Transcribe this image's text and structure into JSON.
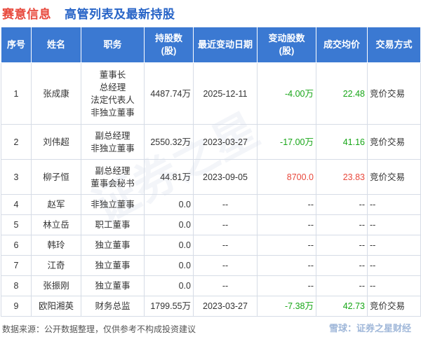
{
  "header": {
    "company": "赛意信息",
    "title": "高管列表及最新持股"
  },
  "table": {
    "columns": [
      "序号",
      "姓名",
      "职务",
      "持股数\n(股)",
      "最近变动日期",
      "变动股数\n(股)",
      "成交均价",
      "交易方式"
    ],
    "rows": [
      {
        "no": "1",
        "name": "张成康",
        "roles": [
          "董事长",
          "总经理",
          "法定代表人",
          "非独立董事"
        ],
        "shares": "4487.74万",
        "date": "2025-12-11",
        "change": "-4.00万",
        "change_color": "#17a617",
        "price": "22.48",
        "price_color": "#17a617",
        "method": "竞价交易"
      },
      {
        "no": "2",
        "name": "刘伟超",
        "roles": [
          "副总经理",
          "非独立董事"
        ],
        "shares": "2550.32万",
        "date": "2023-03-27",
        "change": "-17.00万",
        "change_color": "#17a617",
        "price": "41.16",
        "price_color": "#17a617",
        "method": "竞价交易"
      },
      {
        "no": "3",
        "name": "柳子恒",
        "roles": [
          "副总经理",
          "董事会秘书"
        ],
        "shares": "44.81万",
        "date": "2023-09-05",
        "change": "8700.0",
        "change_color": "#e8483c",
        "price": "23.83",
        "price_color": "#e8483c",
        "method": "竞价交易"
      },
      {
        "no": "4",
        "name": "赵军",
        "roles": [
          "非独立董事"
        ],
        "shares": "0.0",
        "date": "--",
        "change": "--",
        "change_color": "#333333",
        "price": "--",
        "price_color": "#333333",
        "method": "--"
      },
      {
        "no": "5",
        "name": "林立岳",
        "roles": [
          "职工董事"
        ],
        "shares": "0.0",
        "date": "--",
        "change": "--",
        "change_color": "#333333",
        "price": "--",
        "price_color": "#333333",
        "method": "--"
      },
      {
        "no": "6",
        "name": "韩玲",
        "roles": [
          "独立董事"
        ],
        "shares": "0.0",
        "date": "--",
        "change": "--",
        "change_color": "#333333",
        "price": "--",
        "price_color": "#333333",
        "method": "--"
      },
      {
        "no": "7",
        "name": "江奇",
        "roles": [
          "独立董事"
        ],
        "shares": "0.0",
        "date": "--",
        "change": "--",
        "change_color": "#333333",
        "price": "--",
        "price_color": "#333333",
        "method": "--"
      },
      {
        "no": "8",
        "name": "张振刚",
        "roles": [
          "独立董事"
        ],
        "shares": "0.0",
        "date": "--",
        "change": "--",
        "change_color": "#333333",
        "price": "--",
        "price_color": "#333333",
        "method": "--"
      },
      {
        "no": "9",
        "name": "欧阳湘英",
        "roles": [
          "财务总监"
        ],
        "shares": "1799.55万",
        "date": "2023-03-27",
        "change": "-7.38万",
        "change_color": "#17a617",
        "price": "42.73",
        "price_color": "#17a617",
        "method": "竞价交易"
      }
    ]
  },
  "footer": {
    "source": "数据来源：公开数据整理，仅供参考不构成投资建议",
    "brand": "雪球：证券之星财经"
  },
  "watermark": "证券之星",
  "colors": {
    "header_bg": "#3b79d2",
    "company_red": "#e8483c",
    "title_blue": "#2764c7",
    "positive_green": "#17a617",
    "negative_red": "#e8483c"
  }
}
